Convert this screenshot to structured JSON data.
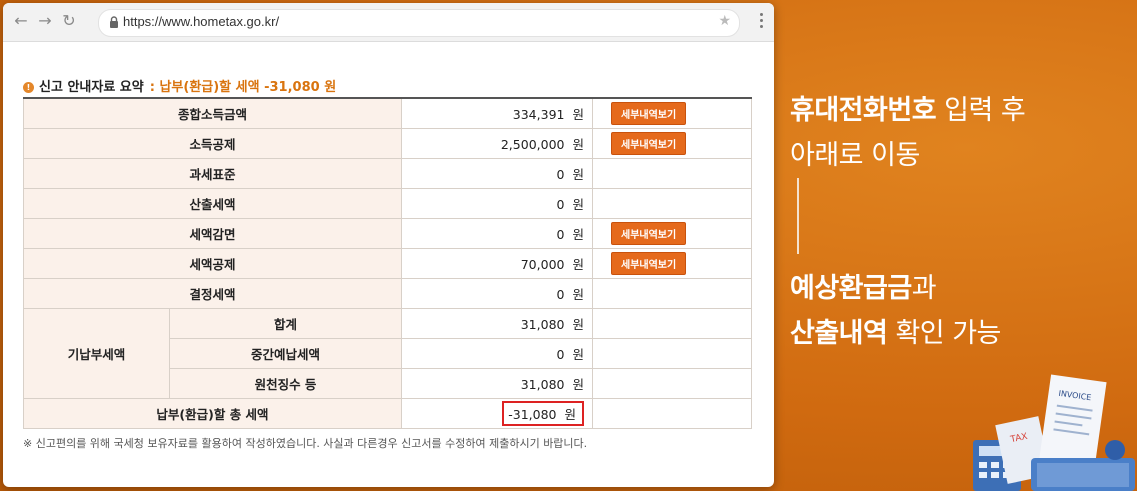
{
  "browser": {
    "url": "https://www.hometax.go.kr/"
  },
  "summary": {
    "title": "신고 안내자료 요약",
    "subtitle": ": 납부(환급)할 세액 -31,080 원",
    "detail_label": "세부내역보기",
    "unit": "원",
    "rows": {
      "income_total": {
        "label": "종합소득금액",
        "value": "334,391"
      },
      "deduction": {
        "label": "소득공제",
        "value": "2,500,000"
      },
      "tax_base": {
        "label": "과세표준",
        "value": "0"
      },
      "calc_tax": {
        "label": "산출세액",
        "value": "0"
      },
      "reduction": {
        "label": "세액감면",
        "value": "0"
      },
      "credit": {
        "label": "세액공제",
        "value": "70,000"
      },
      "determined": {
        "label": "결정세액",
        "value": "0"
      },
      "prepaid_group": "기납부세액",
      "prepaid_total": {
        "label": "합계",
        "value": "31,080"
      },
      "interim": {
        "label": "중간예납세액",
        "value": "0"
      },
      "withholding": {
        "label": "원천징수 등",
        "value": "31,080"
      },
      "final": {
        "label": "납부(환급)할 총 세액",
        "value": "-31,080"
      }
    },
    "note": "※ 신고편의를 위해 국세청 보유자료를 활용하여 작성하였습니다. 사실과 다른경우 신고서를 수정하여 제출하시기 바랍니다."
  },
  "caption": {
    "line1_bold": "휴대전화번호",
    "line1_rest": " 입력 후",
    "line2": "아래로 이동",
    "line3_bold": "예상환급금",
    "line3_rest": "과",
    "line4_bold": "산출내역",
    "line4_rest": " 확인 가능"
  },
  "illustration": {
    "invoice_label": "INVOICE",
    "tax_label": "TAX"
  },
  "colors": {
    "background": "#d5700f",
    "accent": "#e56a1c",
    "highlight_border": "#dd2222"
  }
}
